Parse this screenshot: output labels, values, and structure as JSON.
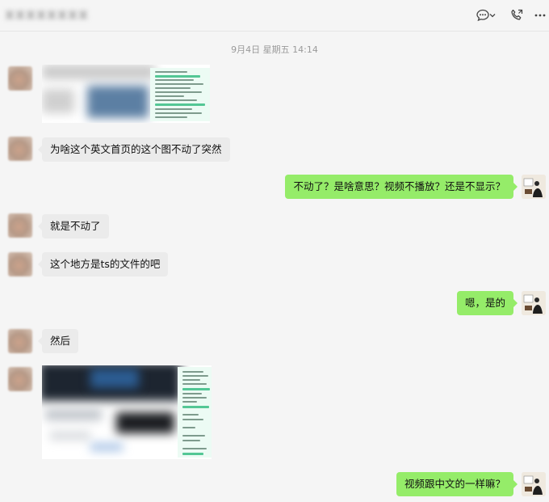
{
  "header": {
    "chat_title": "某某某某某某某某",
    "icons": [
      "chat-options-icon",
      "chevron-down-icon",
      "voice-call-icon",
      "more-icon"
    ]
  },
  "timestamp": "9月4日 星期五 14:14",
  "messages": [
    {
      "sender": "other",
      "type": "image",
      "desc": "blurred-screenshot"
    },
    {
      "sender": "other",
      "type": "text",
      "text": "为啥这个英文首页的这个图不动了突然"
    },
    {
      "sender": "self",
      "type": "text",
      "text": "不动了？是啥意思？视频不播放？还是不显示？"
    },
    {
      "sender": "other",
      "type": "text",
      "text": "就是不动了"
    },
    {
      "sender": "other",
      "type": "text",
      "text": "这个地方是ts的文件的吧"
    },
    {
      "sender": "self",
      "type": "text",
      "text": "嗯，是的"
    },
    {
      "sender": "other",
      "type": "text",
      "text": "然后"
    },
    {
      "sender": "other",
      "type": "image",
      "desc": "blurred-screenshot"
    },
    {
      "sender": "self",
      "type": "text",
      "text": "视频跟中文的一样嘛？"
    }
  ],
  "colors": {
    "outgoing_bubble": "#95ec69",
    "incoming_bubble": "#ebebeb",
    "background": "#f5f5f5"
  }
}
